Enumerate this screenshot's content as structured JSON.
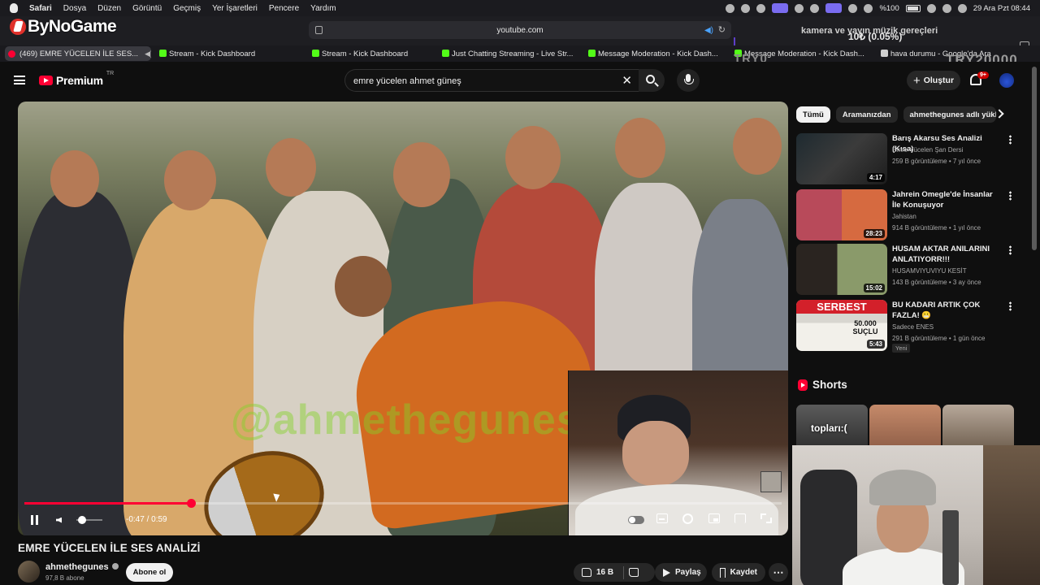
{
  "menubar": {
    "app": "Safari",
    "items": [
      "Dosya",
      "Düzen",
      "Görüntü",
      "Geçmiş",
      "Yer İşaretleri",
      "Pencere",
      "Yardım"
    ],
    "battery": "%100",
    "datetime": "29 Ara Pzt  08:44"
  },
  "overlay": {
    "brand": "ByNoGame",
    "music_title": "kamera ve yayın müzik gereçleri",
    "counter": "10₺ (0.05%)",
    "try_left": "TRY0",
    "try_right": "TRY20000"
  },
  "browser": {
    "url": "youtube.com",
    "tabs": [
      {
        "label": "(469) EMRE YÜCELEN İLE SES..."
      },
      {
        "label": "Stream - Kick Dashboard"
      },
      {
        "label": "Stream - Kick Dashboard"
      },
      {
        "label": "Just Chatting Streaming - Live Str..."
      },
      {
        "label": "Message Moderation - Kick Dash..."
      },
      {
        "label": "Message Moderation - Kick Dash..."
      },
      {
        "label": "hava durumu - Google'da Ara"
      }
    ]
  },
  "youtube": {
    "logo": "Premium",
    "country": "TR",
    "search_value": "emre yücelen ahmet güneş",
    "create_label": "Oluştur",
    "notif_count": "9+"
  },
  "player": {
    "watermark": "@ahmethegunes",
    "time": "-0:47 / 0:59",
    "progress": 0.22
  },
  "video": {
    "title": "EMRE YÜCELEN İLE SES ANALİZİ",
    "channel": "ahmethegunes",
    "subscribers": "97,8 B abone",
    "subscribe_label": "Abone ol",
    "likes": "16 B",
    "share_label": "Paylaş",
    "save_label": "Kaydet"
  },
  "chips": [
    "Tümü",
    "Aramanızdan",
    "ahmethegunes adlı yükle"
  ],
  "recommendations": [
    {
      "title": "Barış Akarsu Ses Analizi (Kısa)",
      "channel": "Emre Yücelen Şan Dersi",
      "meta": "259 B görüntüleme • 7 yıl önce",
      "duration": "4:17"
    },
    {
      "title": "Jahrein Omegle'de İnsanlar İle Konuşuyor",
      "channel": "Jahistan",
      "meta": "914 B görüntüleme • 1 yıl önce",
      "duration": "28:23"
    },
    {
      "title": "HUSAM AKTAR ANILARINI ANLATIYORR!!!",
      "channel": "HUSAMVIYUVIYU KESİT",
      "meta": "143 B görüntüleme • 3 ay önce",
      "duration": "15:02"
    },
    {
      "title": "BU KADARI ARTIK ÇOK FAZLA! 😬",
      "channel": "Sadece ENES",
      "meta": "291 B görüntüleme • 1 gün önce",
      "duration": "5:43",
      "badge": "Yeni"
    }
  ],
  "thumb_text": {
    "serbest": "SERBEST",
    "suclu": "50.000 SUÇLU"
  },
  "shorts": {
    "title": "Shorts",
    "first_caption": "topları:("
  }
}
